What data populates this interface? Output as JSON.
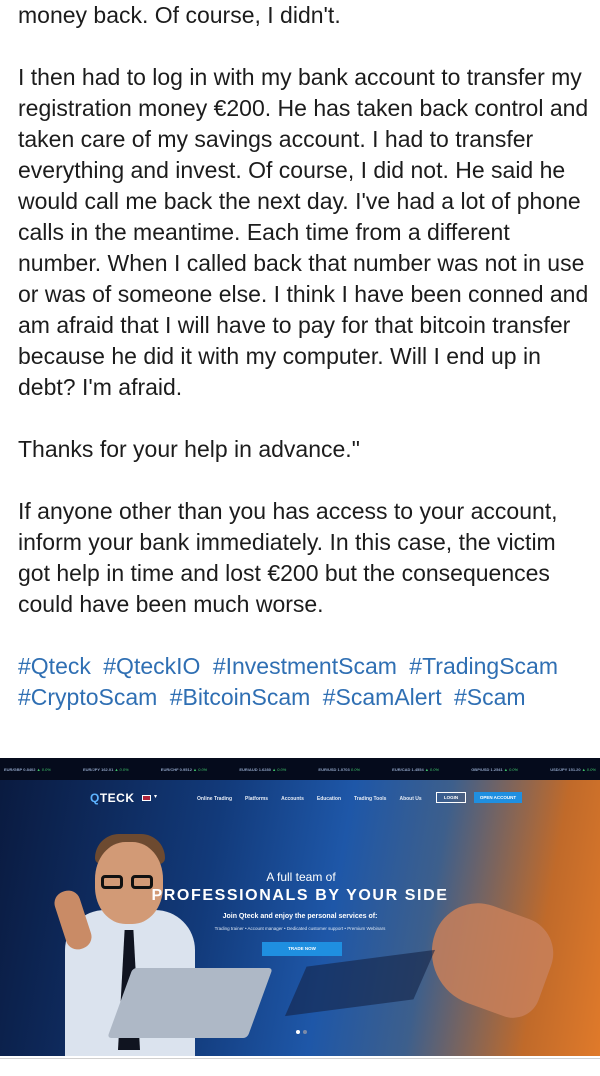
{
  "post": {
    "paragraphs": [
      "money back. Of course, I didn't.",
      "I then had to log in with my bank account to transfer my registration money €200. He has taken back control and taken care of my savings account. I had to transfer everything and invest. Of course, I did not. He said he would call me back the next day. I've had a lot of phone calls in the meantime. Each time from a different number. When I called back that number was not in use or was of someone else. I think I have been conned and am afraid that I will have to pay for that bitcoin transfer because he did it with my computer. Will I end up in debt? I'm afraid.",
      "Thanks for your help in advance.\"",
      "If anyone other than you has access to your account, inform your bank immediately. In this case, the victim got help in time and lost €200 but the consequences could have been much worse."
    ],
    "hashtags": [
      "#Qteck",
      "#QteckIO",
      "#InvestmentScam",
      "#TradingScam",
      "#CryptoScam",
      "#BitcoinScam",
      "#ScamAlert",
      "#Scam"
    ]
  },
  "site": {
    "ticker": [
      {
        "symbol": "EUR/GBP 0.8402",
        "change": "▲ 0.0%"
      },
      {
        "symbol": "EUR/JPY 162.01",
        "change": "▲ 0.0%"
      },
      {
        "symbol": "EUR/CHF 0.9512",
        "change": "▲ 0.0%"
      },
      {
        "symbol": "EUR/AUD 1.6280",
        "change": "▲ 0.0%"
      },
      {
        "symbol": "EUR/USD 1.0703",
        "change": "0.0%"
      },
      {
        "symbol": "EUR/CAD 1.4554",
        "change": "▲ 0.0%"
      },
      {
        "symbol": "GBP/USD 1.2541",
        "change": "▲ 0.0%"
      },
      {
        "symbol": "USD/JPY 151.20",
        "change": "▲ 0.0%"
      }
    ],
    "logo": {
      "q": "Q",
      "rest": "TECK"
    },
    "nav": [
      "Online Trading",
      "Platforms",
      "Accounts",
      "Education",
      "Trading Tools",
      "About Us"
    ],
    "login": "LOGIN",
    "open_account": "OPEN ACCOUNT",
    "hero": {
      "sub": "A full team of",
      "title": "PROFESSIONALS BY YOUR SIDE",
      "join": "Join Qteck and enjoy the personal services of:",
      "services": "Trading trainer  •  Account manager  •  Dedicated customer support  •  Premium Webinars",
      "cta": "TRADE NOW"
    }
  }
}
